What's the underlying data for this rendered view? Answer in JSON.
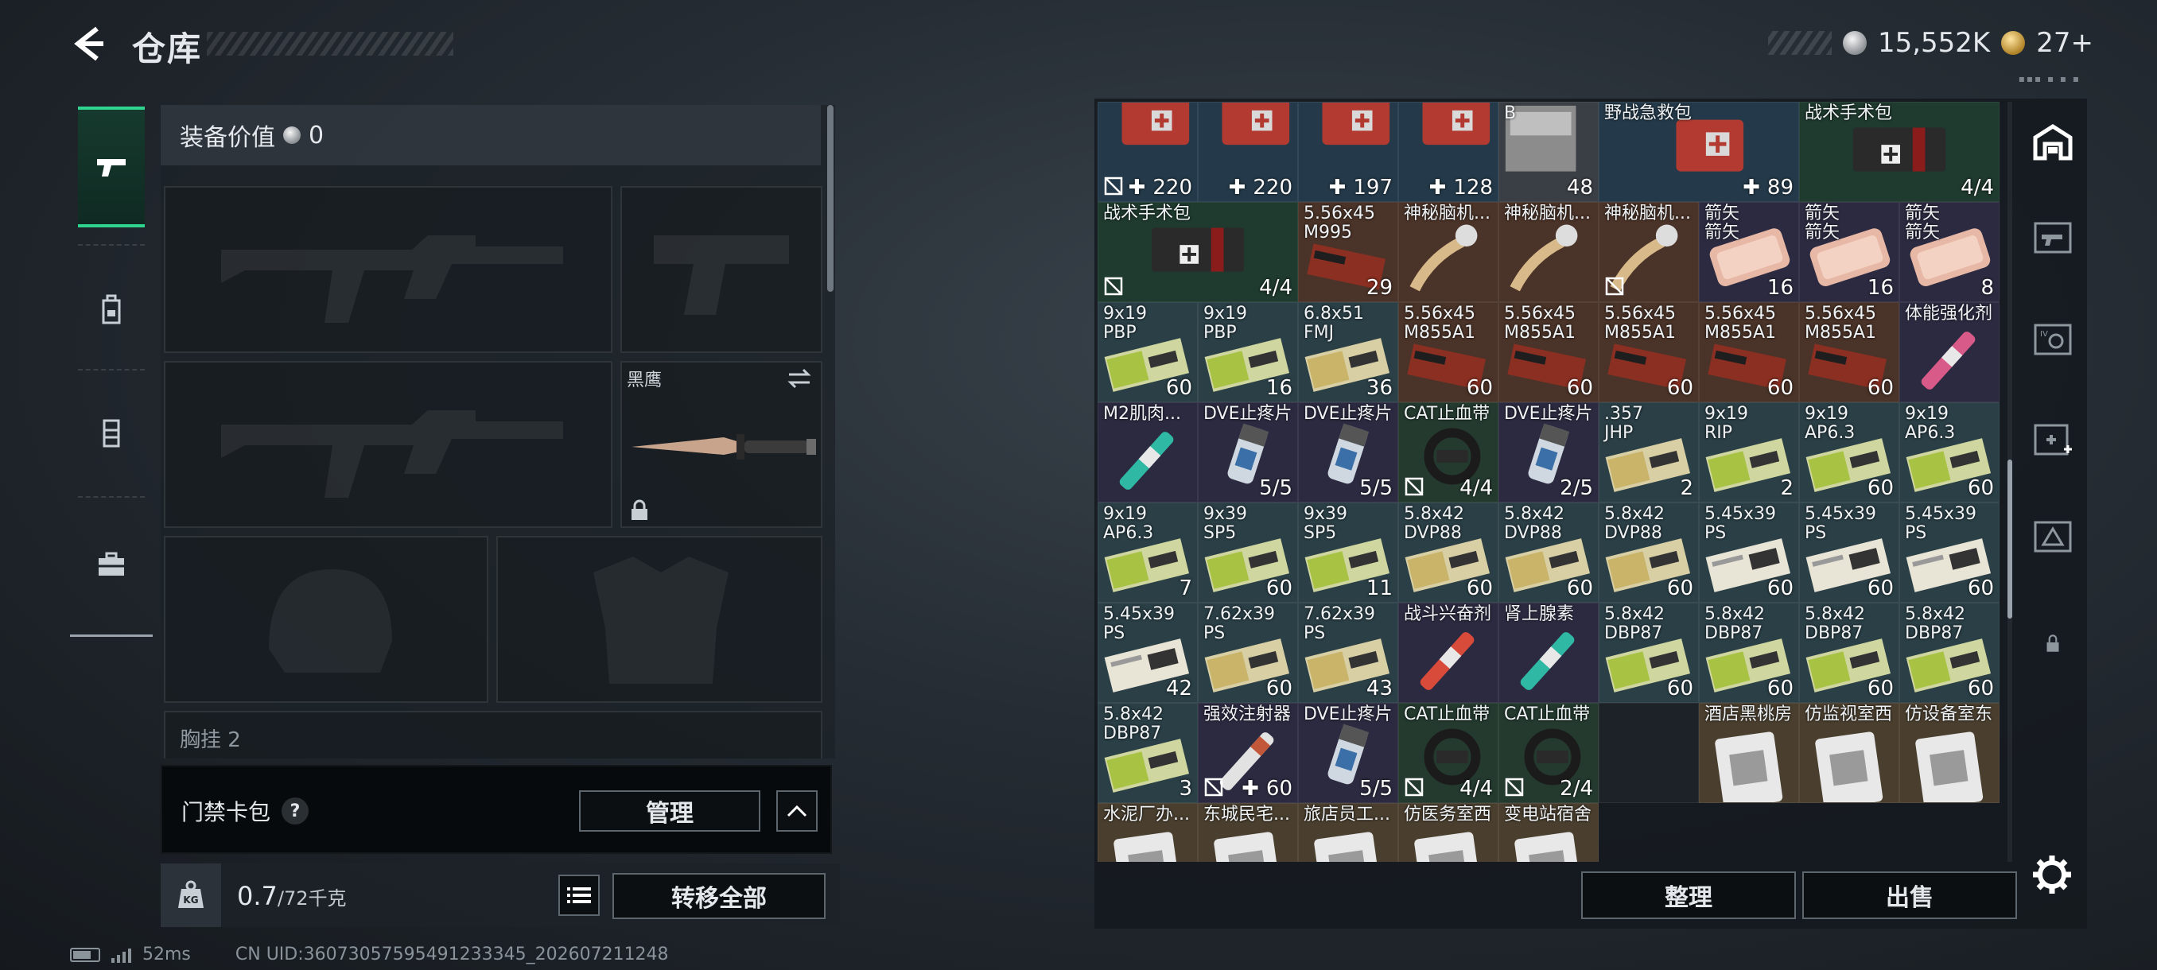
{
  "header": {
    "title": "仓库"
  },
  "currency": {
    "silver": "15,552K",
    "gold": "27+",
    "tiny": "▪▪▪ ▪ ▪ ▪"
  },
  "equipment": {
    "value_label": "装备价值",
    "value": "0",
    "melee_label": "黑鹰",
    "chest_label": "胸挂 2"
  },
  "keycard": {
    "label": "门禁卡包",
    "help": "?",
    "manage": "管理"
  },
  "weight": {
    "current": "0.7",
    "max": "/72千克",
    "transfer": "转移全部"
  },
  "status": {
    "ping": "52ms",
    "uid": "CN UID:3607305759549123334​5_202607211248"
  },
  "storage": {
    "sort": "整理",
    "sell": "出售",
    "cells": [
      {
        "name": "",
        "qty": "220",
        "plus": true,
        "noicon": true,
        "kind": "medkit"
      },
      {
        "name": "",
        "qty": "220",
        "plus": true,
        "noicon": false,
        "kind": "medkit"
      },
      {
        "name": "",
        "qty": "197",
        "plus": true,
        "noicon": false,
        "kind": "medkit"
      },
      {
        "name": "",
        "qty": "128",
        "plus": true,
        "noicon": false,
        "kind": "medkit"
      },
      {
        "name": "B",
        "qty": "48",
        "plus": false,
        "noicon": false,
        "kind": "box"
      },
      {
        "name": "野战急救包",
        "qty": "89",
        "plus": true,
        "noicon": false,
        "kind": "medkit2"
      },
      {
        "name": "",
        "qty": "",
        "plus": false,
        "noicon": false,
        "kind": "span"
      },
      {
        "name": "战术手术包",
        "qty": "4/4",
        "plus": false,
        "noicon": false,
        "kind": "surgical"
      },
      {
        "name": "",
        "qty": "",
        "plus": false,
        "noicon": false,
        "kind": "span"
      },
      {
        "name": "战术手术包",
        "qty": "4/4",
        "plus": false,
        "noicon": true,
        "kind": "surgical"
      },
      {
        "name": "",
        "qty": "",
        "plus": false,
        "noicon": false,
        "kind": "span"
      },
      {
        "name": "5.56x45\nM995",
        "qty": "29",
        "plus": false,
        "noicon": false,
        "kind": "ammo-red"
      },
      {
        "name": "神秘脑机...",
        "qty": "",
        "plus": false,
        "noicon": false,
        "kind": "brain"
      },
      {
        "name": "神秘脑机...",
        "qty": "",
        "plus": false,
        "noicon": false,
        "kind": "brain"
      },
      {
        "name": "神秘脑机...",
        "qty": "",
        "plus": false,
        "noicon": true,
        "kind": "brain"
      },
      {
        "name": "箭矢\n箭矢",
        "qty": "16",
        "plus": false,
        "noicon": false,
        "kind": "pink"
      },
      {
        "name": "箭矢\n箭矢",
        "qty": "16",
        "plus": false,
        "noicon": false,
        "kind": "pink"
      },
      {
        "name": "箭矢\n箭矢",
        "qty": "8",
        "plus": false,
        "noicon": false,
        "kind": "pink"
      },
      {
        "name": "9x19\nPBP",
        "qty": "60",
        "plus": false,
        "noicon": false,
        "kind": "ammo-green"
      },
      {
        "name": "9x19\nPBP",
        "qty": "16",
        "plus": false,
        "noicon": false,
        "kind": "ammo-green"
      },
      {
        "name": "6.8x51\nFMJ",
        "qty": "36",
        "plus": false,
        "noicon": false,
        "kind": "ammo-tan"
      },
      {
        "name": "5.56x45\nM855A1",
        "qty": "60",
        "plus": false,
        "noicon": false,
        "kind": "ammo-red"
      },
      {
        "name": "5.56x45\nM855A1",
        "qty": "60",
        "plus": false,
        "noicon": false,
        "kind": "ammo-red"
      },
      {
        "name": "5.56x45\nM855A1",
        "qty": "60",
        "plus": false,
        "noicon": false,
        "kind": "ammo-red"
      },
      {
        "name": "5.56x45\nM855A1",
        "qty": "60",
        "plus": false,
        "noicon": false,
        "kind": "ammo-red"
      },
      {
        "name": "5.56x45\nM855A1",
        "qty": "60",
        "plus": false,
        "noicon": false,
        "kind": "ammo-red"
      },
      {
        "name": "体能强化剂",
        "qty": "",
        "plus": false,
        "noicon": false,
        "kind": "inj-pink"
      },
      {
        "name": "M2肌肉...",
        "qty": "",
        "plus": false,
        "noicon": false,
        "kind": "inj-teal"
      },
      {
        "name": "DVE止疼片",
        "qty": "5/5",
        "plus": false,
        "noicon": false,
        "kind": "pill"
      },
      {
        "name": "DVE止疼片",
        "qty": "5/5",
        "plus": false,
        "noicon": false,
        "kind": "pill"
      },
      {
        "name": "CAT止血带",
        "qty": "4/4",
        "plus": false,
        "noicon": true,
        "kind": "tourniquet"
      },
      {
        "name": "DVE止疼片",
        "qty": "2/5",
        "plus": false,
        "noicon": false,
        "kind": "pill"
      },
      {
        "name": ".357\nJHP",
        "qty": "2",
        "plus": false,
        "noicon": false,
        "kind": "ammo-tan"
      },
      {
        "name": "9x19\nRIP",
        "qty": "2",
        "plus": false,
        "noicon": false,
        "kind": "ammo-green"
      },
      {
        "name": "9x19\nAP6.3",
        "qty": "60",
        "plus": false,
        "noicon": false,
        "kind": "ammo-green"
      },
      {
        "name": "9x19\nAP6.3",
        "qty": "60",
        "plus": false,
        "noicon": false,
        "kind": "ammo-green"
      },
      {
        "name": "9x19\nAP6.3",
        "qty": "7",
        "plus": false,
        "noicon": false,
        "kind": "ammo-green"
      },
      {
        "name": "9x39\nSP5",
        "qty": "60",
        "plus": false,
        "noicon": false,
        "kind": "ammo-green"
      },
      {
        "name": "9x39\nSP5",
        "qty": "11",
        "plus": false,
        "noicon": false,
        "kind": "ammo-green"
      },
      {
        "name": "5.8x42\nDVP88",
        "qty": "60",
        "plus": false,
        "noicon": false,
        "kind": "ammo-tan"
      },
      {
        "name": "5.8x42\nDVP88",
        "qty": "60",
        "plus": false,
        "noicon": false,
        "kind": "ammo-tan"
      },
      {
        "name": "5.8x42\nDVP88",
        "qty": "60",
        "plus": false,
        "noicon": false,
        "kind": "ammo-tan"
      },
      {
        "name": "5.45x39\nPS",
        "qty": "60",
        "plus": false,
        "noicon": false,
        "kind": "ammo-white"
      },
      {
        "name": "5.45x39\nPS",
        "qty": "60",
        "plus": false,
        "noicon": false,
        "kind": "ammo-white"
      },
      {
        "name": "5.45x39\nPS",
        "qty": "60",
        "plus": false,
        "noicon": false,
        "kind": "ammo-white"
      },
      {
        "name": "5.45x39\nPS",
        "qty": "42",
        "plus": false,
        "noicon": false,
        "kind": "ammo-white"
      },
      {
        "name": "7.62x39\nPS",
        "qty": "60",
        "plus": false,
        "noicon": false,
        "kind": "ammo-tan"
      },
      {
        "name": "7.62x39\nPS",
        "qty": "43",
        "plus": false,
        "noicon": false,
        "kind": "ammo-tan"
      },
      {
        "name": "战斗兴奋剂",
        "qty": "",
        "plus": false,
        "noicon": false,
        "kind": "inj-red"
      },
      {
        "name": "肾上腺素",
        "qty": "",
        "plus": false,
        "noicon": false,
        "kind": "inj-teal"
      },
      {
        "name": "5.8x42\nDBP87",
        "qty": "60",
        "plus": false,
        "noicon": false,
        "kind": "ammo-green"
      },
      {
        "name": "5.8x42\nDBP87",
        "qty": "60",
        "plus": false,
        "noicon": false,
        "kind": "ammo-green"
      },
      {
        "name": "5.8x42\nDBP87",
        "qty": "60",
        "plus": false,
        "noicon": false,
        "kind": "ammo-green"
      },
      {
        "name": "5.8x42\nDBP87",
        "qty": "60",
        "plus": false,
        "noicon": false,
        "kind": "ammo-green"
      },
      {
        "name": "5.8x42\nDBP87",
        "qty": "3",
        "plus": false,
        "noicon": false,
        "kind": "ammo-green"
      },
      {
        "name": "强效注射器",
        "qty": "60",
        "plus": true,
        "noicon": true,
        "kind": "inj-white"
      },
      {
        "name": "DVE止疼片",
        "qty": "5/5",
        "plus": false,
        "noicon": false,
        "kind": "pill"
      },
      {
        "name": "CAT止血带",
        "qty": "4/4",
        "plus": false,
        "noicon": true,
        "kind": "tourniquet"
      },
      {
        "name": "CAT止血带",
        "qty": "2/4",
        "plus": false,
        "noicon": true,
        "kind": "tourniquet"
      },
      {
        "name": "",
        "qty": "",
        "plus": false,
        "noicon": false,
        "kind": "empty"
      },
      {
        "name": "酒店黑桃房",
        "qty": "",
        "plus": false,
        "noicon": false,
        "kind": "card"
      },
      {
        "name": "仿监视室西",
        "qty": "",
        "plus": false,
        "noicon": false,
        "kind": "card"
      },
      {
        "name": "仿设备室东",
        "qty": "",
        "plus": false,
        "noicon": false,
        "kind": "card"
      },
      {
        "name": "水泥厂办...",
        "qty": "",
        "plus": false,
        "noicon": false,
        "kind": "card"
      },
      {
        "name": "东城民宅...",
        "qty": "",
        "plus": false,
        "noicon": false,
        "kind": "card"
      },
      {
        "name": "旅店员工...",
        "qty": "",
        "plus": false,
        "noicon": false,
        "kind": "card"
      },
      {
        "name": "仿医务室西",
        "qty": "",
        "plus": false,
        "noicon": false,
        "kind": "card"
      },
      {
        "name": "变电站宿舍",
        "qty": "",
        "plus": false,
        "noicon": false,
        "kind": "card"
      }
    ]
  }
}
